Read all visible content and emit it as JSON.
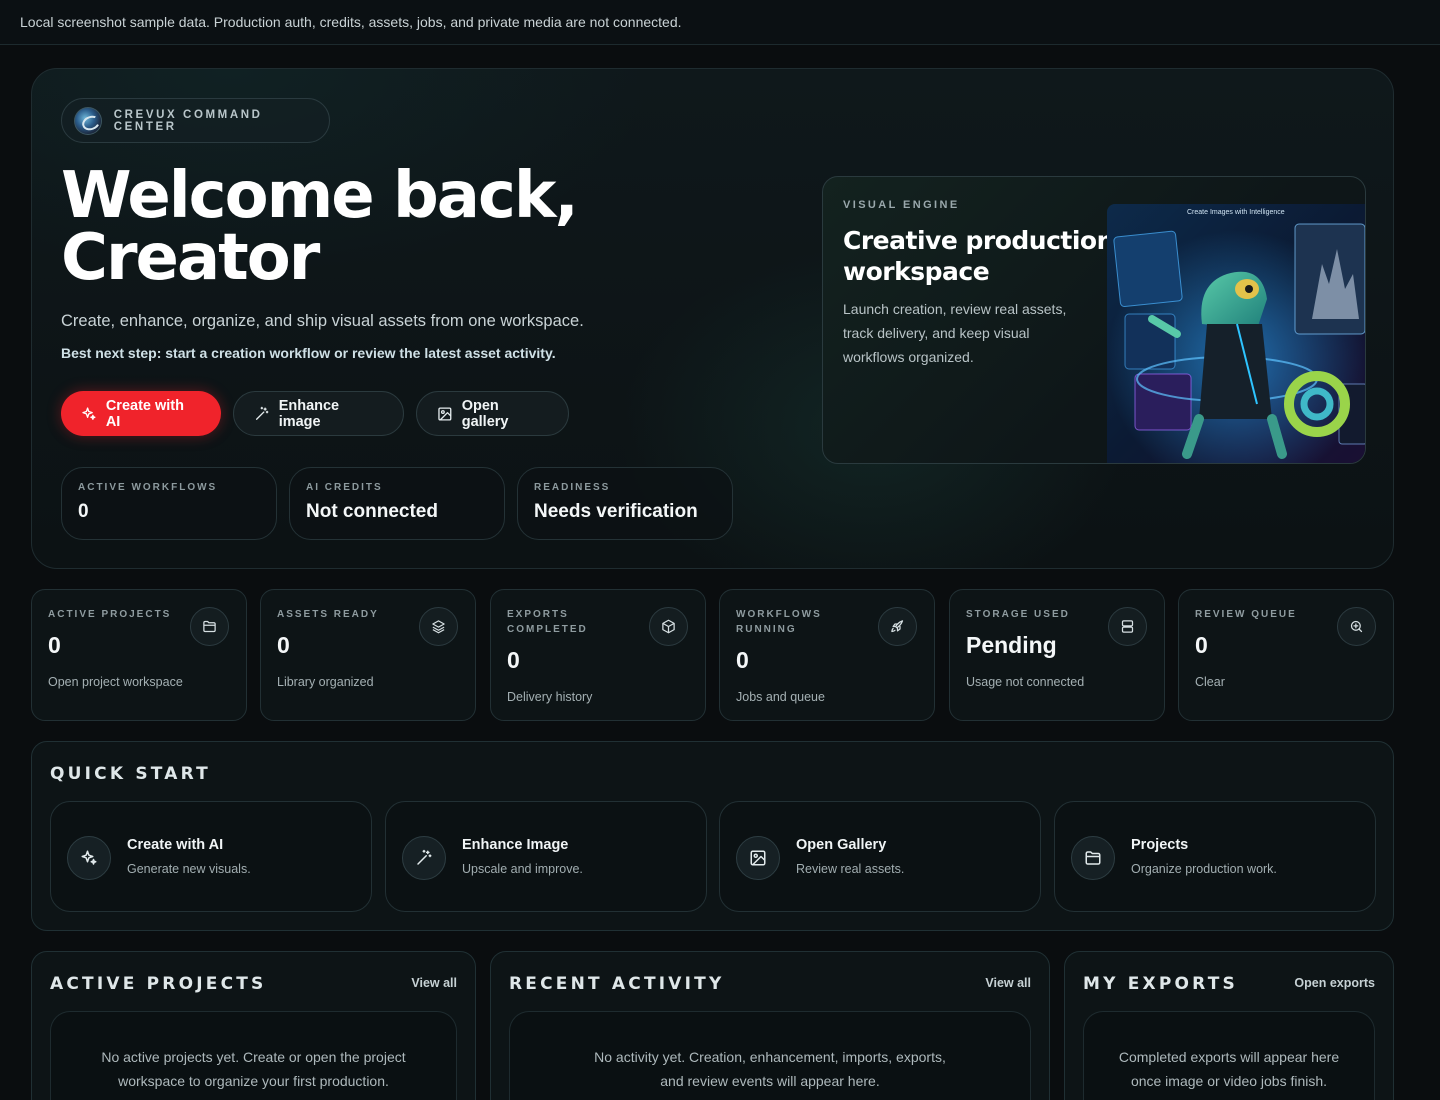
{
  "banner": {
    "text": "Local screenshot sample data. Production auth, credits, assets, jobs, and private media are not connected."
  },
  "hero": {
    "brand": "CREVUX COMMAND CENTER",
    "title_line1": "Welcome back,",
    "title_line2": "Creator",
    "subtitle": "Create, enhance, organize, and ship visual assets from one workspace.",
    "next_step": "Best next step: start a creation workflow or review the latest asset activity.",
    "buttons": {
      "create": "Create with AI",
      "enhance": "Enhance image",
      "gallery": "Open gallery"
    },
    "stats": [
      {
        "label": "ACTIVE WORKFLOWS",
        "value": "0"
      },
      {
        "label": "AI CREDITS",
        "value": "Not connected"
      },
      {
        "label": "READINESS",
        "value": "Needs verification"
      }
    ],
    "engine": {
      "label": "VISUAL ENGINE",
      "title_line1": "Creative production",
      "title_line2": "workspace",
      "text": "Launch creation, review real assets, track delivery, and keep visual workflows organized.",
      "art_caption": "Create Images with Intelligence"
    }
  },
  "metrics": [
    {
      "label": "ACTIVE PROJECTS",
      "value": "0",
      "sub": "Open project workspace",
      "icon": "folder-icon"
    },
    {
      "label": "ASSETS READY",
      "value": "0",
      "sub": "Library organized",
      "icon": "layers-icon"
    },
    {
      "label": "EXPORTS COMPLETED",
      "value": "0",
      "sub": "Delivery history",
      "icon": "package-icon"
    },
    {
      "label": "WORKFLOWS RUNNING",
      "value": "0",
      "sub": "Jobs and queue",
      "icon": "rocket-icon"
    },
    {
      "label": "STORAGE USED",
      "value": "Pending",
      "sub": "Usage not connected",
      "icon": "server-icon"
    },
    {
      "label": "REVIEW QUEUE",
      "value": "0",
      "sub": "Clear",
      "icon": "search-icon"
    }
  ],
  "quick_start": {
    "title": "QUICK START",
    "items": [
      {
        "title": "Create with AI",
        "sub": "Generate new visuals.",
        "icon": "sparkles-icon"
      },
      {
        "title": "Enhance Image",
        "sub": "Upscale and improve.",
        "icon": "magic-wand-icon"
      },
      {
        "title": "Open Gallery",
        "sub": "Review real assets.",
        "icon": "image-icon"
      },
      {
        "title": "Projects",
        "sub": "Organize production work.",
        "icon": "folder-icon"
      }
    ]
  },
  "panels": {
    "projects": {
      "title": "ACTIVE PROJECTS",
      "link": "View all",
      "empty_line1": "No active projects yet. Create or open the project",
      "empty_line2": "workspace to organize your first production."
    },
    "activity": {
      "title": "RECENT ACTIVITY",
      "link": "View all",
      "empty_line1": "No activity yet. Creation, enhancement, imports, exports,",
      "empty_line2": "and review events will appear here."
    },
    "exports": {
      "title": "MY EXPORTS",
      "link": "Open exports",
      "empty_line1": "Completed exports will appear here",
      "empty_line2": "once image or video jobs finish."
    }
  },
  "colors": {
    "accent": "#f0232b",
    "background": "#0a0d0f",
    "panel": "#0d1416"
  }
}
